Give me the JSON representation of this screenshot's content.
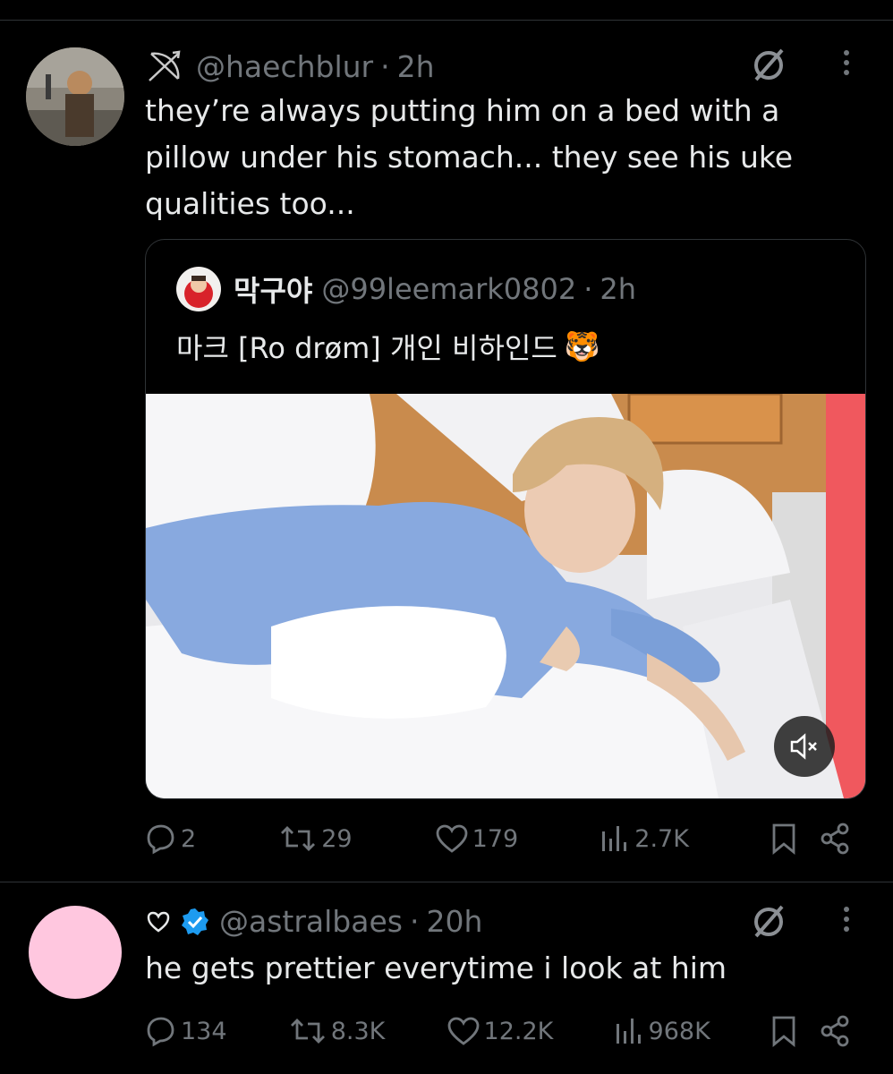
{
  "tweet1": {
    "handle": "@haechblur",
    "time": "2h",
    "text": "they’re always putting him on a bed with a pillow under his stomach... they see his uke qualities too...",
    "actions": {
      "replies": "2",
      "retweets": "29",
      "likes": "179",
      "views": "2.7K"
    }
  },
  "quote": {
    "name": "막구야",
    "handle": "@99leemark0802",
    "time": "2h",
    "text": "마크 [Ro drøm] 개인 비하인드",
    "emoji": "🐯"
  },
  "tweet2": {
    "handle": "@astralbaes",
    "time": "20h",
    "text": "he gets prettier everytime i look at him",
    "actions": {
      "replies": "134",
      "retweets": "8.3K",
      "likes": "12.2K",
      "views": "968K"
    }
  },
  "colors": {
    "background": "#000000",
    "muted": "#71767b",
    "text": "#e7e9ea",
    "verified": "#1d9bf0",
    "divider": "#2f3336"
  },
  "icons": [
    "bow-arrow-icon",
    "grok-icon",
    "more-icon",
    "reply-icon",
    "retweet-icon",
    "like-icon",
    "views-icon",
    "bookmark-icon",
    "share-icon",
    "heart-outline-icon",
    "verified-badge-icon",
    "mute-icon"
  ]
}
